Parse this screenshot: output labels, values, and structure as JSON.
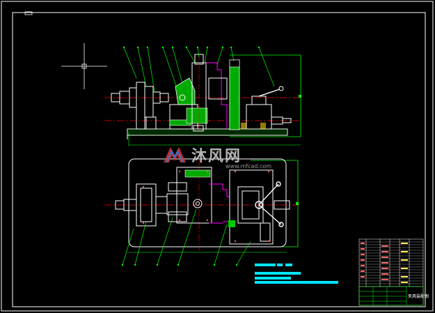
{
  "watermark": {
    "text": "沐风网",
    "url": "www.mfcad.com",
    "logo_colors": [
      "#d23b3b",
      "#3b6fd2"
    ]
  },
  "title_block": {
    "caption": "夹具装配图"
  },
  "colors": {
    "background": "#000000",
    "frame": "#ffffff",
    "leader": "#00ff00",
    "hatch": "#00cc00",
    "centerline": "#ff0000",
    "accent_magenta": "#ff00ff",
    "notes": "#00ffff",
    "outline": "#ffffff"
  },
  "balloons": {
    "top_view": [
      "1",
      "2",
      "3",
      "4",
      "5",
      "6",
      "7",
      "8",
      "9",
      "10",
      "11",
      "12"
    ],
    "bottom_view": [
      "13",
      "14",
      "15",
      "16",
      "17",
      "18",
      "19"
    ]
  }
}
